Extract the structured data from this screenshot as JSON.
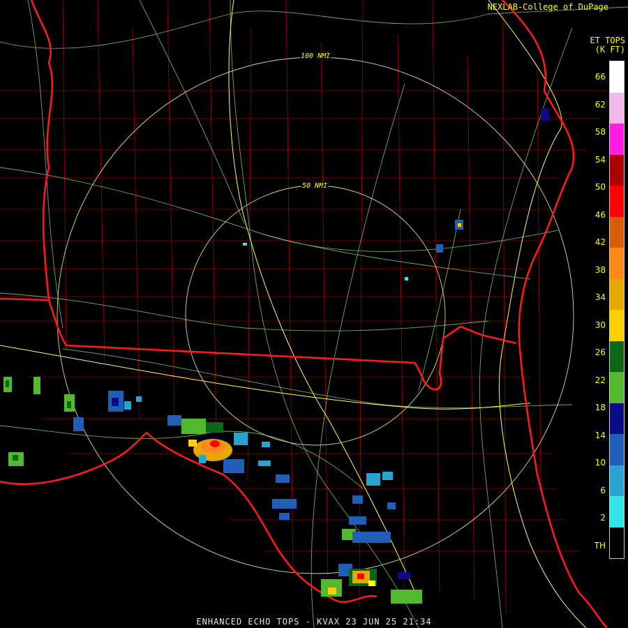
{
  "credit": "NEXLAB-College of DuPage",
  "product_label": [
    "ET TOPS",
    "(K FT)"
  ],
  "footer": "ENHANCED ECHO TOPS - KVAX 23 JUN 25 21:34",
  "range_rings": [
    {
      "label": "50 NMI"
    },
    {
      "label": "100 NMI"
    }
  ],
  "legend": {
    "colors": [
      "#000000",
      "#33e6e6",
      "#29a3d1",
      "#1f5fb8",
      "#0b0b85",
      "#52b82e",
      "#0d6614",
      "#ffd000",
      "#e6a800",
      "#ff8a1a",
      "#d95c0a",
      "#ff0000",
      "#aa0000",
      "#ff1ee6",
      "#f2b8ee",
      "#ffffff"
    ],
    "labels": [
      "TH",
      "2",
      "6",
      "10",
      "14",
      "18",
      "22",
      "26",
      "30",
      "34",
      "38",
      "42",
      "46",
      "50",
      "54",
      "58",
      "62",
      "66"
    ]
  },
  "colors": {
    "state_border": "#ff1a1a",
    "county_border": "#b00000",
    "highway": "#7fc97f",
    "interstate": "#ffff55",
    "range_ring": "#e6d98a"
  }
}
